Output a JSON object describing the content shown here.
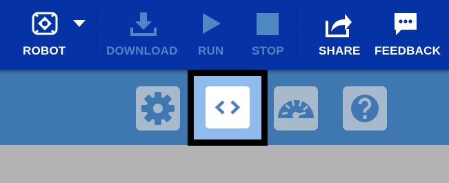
{
  "toolbar": {
    "robot_label": "ROBOT",
    "download_label": "DOWNLOAD",
    "run_label": "RUN",
    "stop_label": "STOP",
    "share_label": "SHARE",
    "feedback_label": "FEEDBACK"
  },
  "icons": {
    "robot": "robot-icon",
    "dropdown": "chevron-down-icon",
    "download": "download-icon",
    "run": "play-icon",
    "stop": "stop-icon",
    "share": "share-icon",
    "feedback": "chat-bubble-icon",
    "settings": "gear-icon",
    "code": "code-brackets-icon",
    "dashboard": "gauge-icon",
    "help": "question-mark-icon"
  },
  "panel": {
    "selected_button": "code"
  },
  "colors": {
    "toolbar_bg": "#0533a6",
    "disabled_text": "#4f86c4",
    "panel_bg": "#3f78b0",
    "button_bg": "#a9b9cc",
    "selected_bg": "#8fbcec",
    "workspace_bg": "#b3b3b3"
  }
}
